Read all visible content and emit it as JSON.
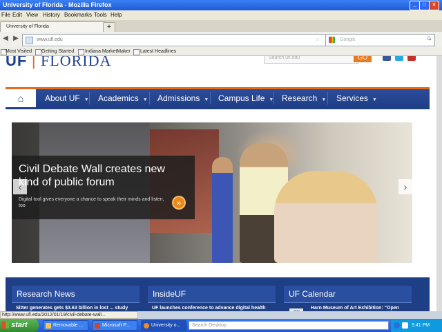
{
  "window": {
    "title": "University of Florida - Mozilla Firefox"
  },
  "menu": [
    "File",
    "Edit",
    "View",
    "History",
    "Bookmarks",
    "Tools",
    "Help"
  ],
  "tab": {
    "label": "University of Florida"
  },
  "nav": {
    "url": "www.ufl.edu",
    "search_placeholder": "Google"
  },
  "bookmarks": [
    "Most Visited",
    "Getting Started",
    "Indiana MarketMaker",
    "Latest Headlines"
  ],
  "site": {
    "logo_uf": "UF",
    "logo_text": "FLORIDA",
    "search_placeholder": "Search ufl.edu",
    "search_button": "GO",
    "menu": [
      "About UF",
      "Academics",
      "Admissions",
      "Campus Life",
      "Research",
      "Services"
    ]
  },
  "hero": {
    "headline": "Civil Debate Wall creates new kind of public forum",
    "subtext": "Digital tool gives everyone a chance to speak their minds and listen, too"
  },
  "panels": {
    "research": {
      "title": "Research News",
      "text": "Sitter generates gets $3.63 billion in lost ... study shows"
    },
    "insideuf": {
      "title": "InsideUF",
      "text": "UF launches conference to advance digital health communication innovations"
    },
    "calendar": {
      "title": "UF Calendar",
      "month": "JAN",
      "text": "Harn Museum of Art Exhibition: \"Open Engagement: Strategies in ..."
    }
  },
  "status": {
    "text": "http://www.ufl.edu/2012/01/19/civil-debate-wall..."
  },
  "taskbar": {
    "start": "start",
    "items": [
      "Removable ...",
      "Microsoft P...",
      "University o..."
    ],
    "search_placeholder": "Search Desktop",
    "clock": "5:41 PM"
  },
  "colors": {
    "uf_blue": "#1e3d85",
    "uf_orange": "#e56c1a"
  }
}
